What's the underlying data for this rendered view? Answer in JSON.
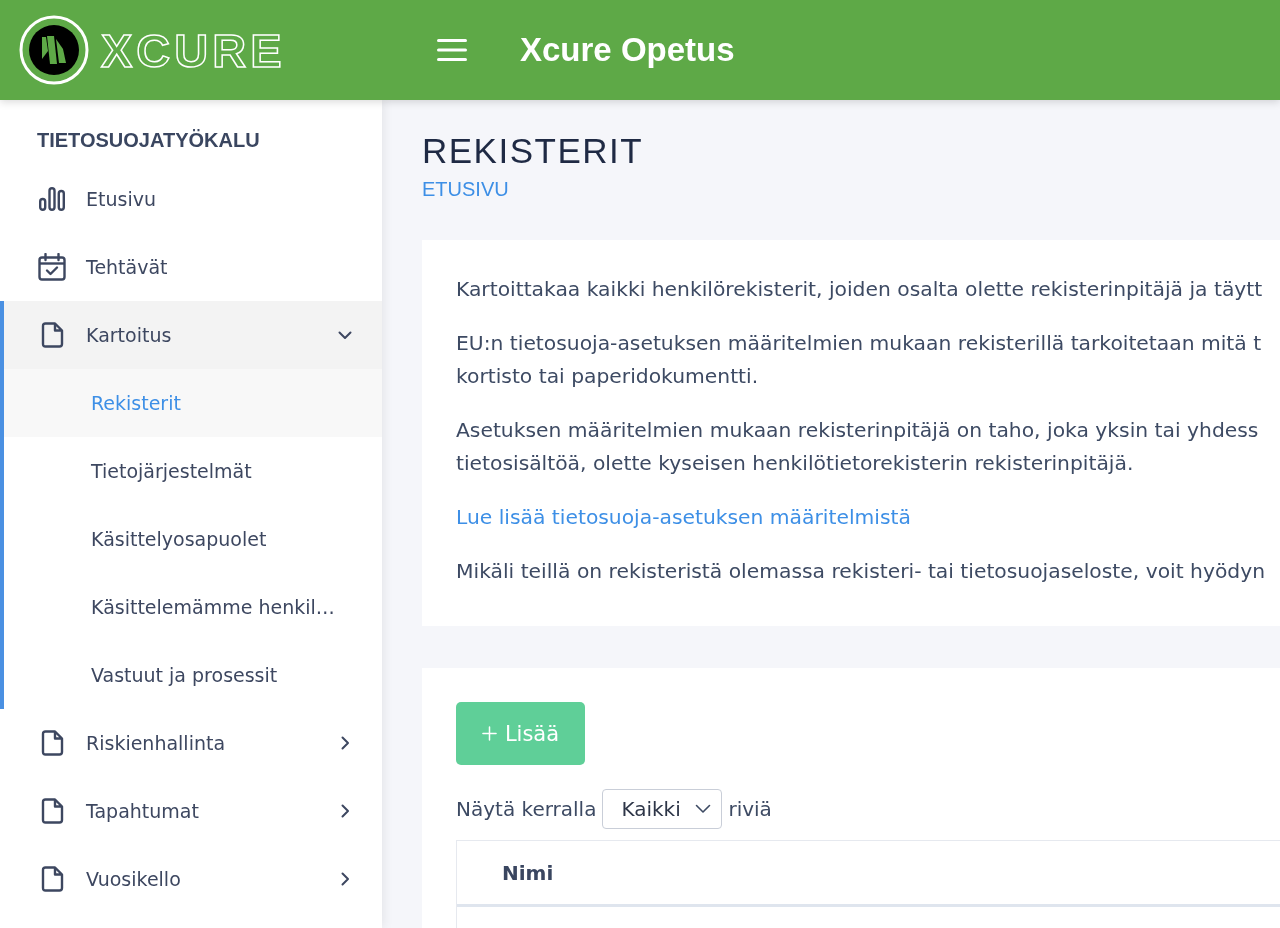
{
  "header": {
    "logo_text": "XCURE",
    "title": "Xcure Opetus"
  },
  "sidebar": {
    "title": "TIETOSUOJATYÖKALU",
    "items": [
      {
        "kind": "dashboard",
        "label": "Etusivu",
        "selected": false
      },
      {
        "kind": "tasks",
        "label": "Tehtävät",
        "selected": false
      },
      {
        "kind": "group",
        "label": "Kartoitus",
        "selected": false,
        "expanded": true,
        "children": [
          {
            "label": "Rekisterit",
            "selected": true
          },
          {
            "label": "Tietojärjestelmät",
            "selected": false
          },
          {
            "label": "Käsittelyosapuolet",
            "selected": false
          },
          {
            "label": "Käsittelemämme henkil…",
            "selected": false
          },
          {
            "label": "Vastuut ja prosessit",
            "selected": false
          }
        ]
      },
      {
        "kind": "group",
        "label": "Riskienhallinta",
        "selected": false,
        "expanded": false
      },
      {
        "kind": "group",
        "label": "Tapahtumat",
        "selected": false,
        "expanded": false
      },
      {
        "kind": "group",
        "label": "Vuosikello",
        "selected": false,
        "expanded": false
      }
    ]
  },
  "page": {
    "title": "REKISTERIT",
    "breadcrumb": "ETUSIVU"
  },
  "info_card": {
    "paragraphs": [
      {
        "kind": "text",
        "lines": [
          "Kartoittakaa kaikki henkilörekisterit, joiden osalta olette rekisterinpitäjä ja täytt"
        ]
      },
      {
        "kind": "text",
        "lines": [
          "EU:n tietosuoja-asetuksen määritelmien mukaan rekisterillä tarkoitetaan mitä t",
          "kortisto tai paperidokumentti."
        ]
      },
      {
        "kind": "text",
        "lines": [
          "Asetuksen määritelmien mukaan rekisterinpitäjä on taho, joka yksin tai yhdess",
          "tietosisältöä, olette kyseisen henkilötietorekisterin rekisterinpitäjä."
        ]
      },
      {
        "kind": "link",
        "lines": [
          "Lue lisää tietosuoja-asetuksen määritelmistä"
        ]
      },
      {
        "kind": "text",
        "lines": [
          "Mikäli teillä on rekisteristä olemassa rekisteri- tai tietosuojaseloste, voit hyödyn"
        ]
      }
    ]
  },
  "table_card": {
    "add_button": "Lisää",
    "rows_per_page": {
      "prefix": "Näytä kerralla",
      "value": "Kaikki",
      "suffix": "riviä"
    },
    "table": {
      "columns": [
        {
          "label": "Nimi"
        }
      ]
    }
  }
}
